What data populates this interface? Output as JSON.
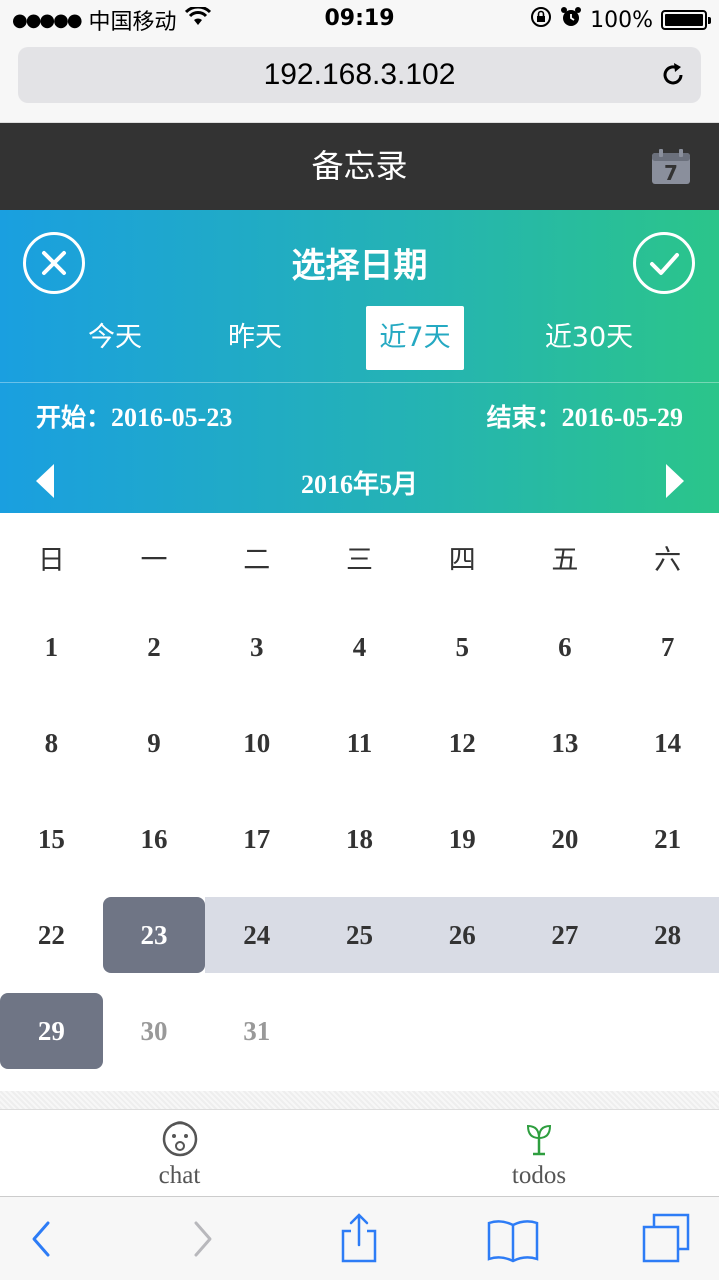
{
  "status_bar": {
    "signal": "●●●●●",
    "carrier": "中国移动",
    "time": "09:19",
    "battery": "100%"
  },
  "browser": {
    "url": "192.168.3.102"
  },
  "app": {
    "title": "备忘录",
    "calendar_icon_day": "7"
  },
  "picker": {
    "title": "选择日期",
    "ranges": [
      {
        "label": "今天",
        "active": false
      },
      {
        "label": "昨天",
        "active": false
      },
      {
        "label": "近7天",
        "active": true
      },
      {
        "label": "近30天",
        "active": false
      }
    ],
    "start_label": "开始：",
    "start_date": "2016-05-23",
    "end_label": "结束：",
    "end_date": "2016-05-29",
    "month": "2016年5月"
  },
  "calendar": {
    "weekdays": [
      "日",
      "一",
      "二",
      "三",
      "四",
      "五",
      "六"
    ],
    "weeks": [
      [
        "1",
        "2",
        "3",
        "4",
        "5",
        "6",
        "7"
      ],
      [
        "8",
        "9",
        "10",
        "11",
        "12",
        "13",
        "14"
      ],
      [
        "15",
        "16",
        "17",
        "18",
        "19",
        "20",
        "21"
      ],
      [
        "22",
        "23",
        "24",
        "25",
        "26",
        "27",
        "28"
      ],
      [
        "29",
        "30",
        "31"
      ]
    ],
    "selected_start": "23",
    "selected_end": "29",
    "muted_days": [
      "30",
      "31"
    ]
  },
  "tabbar": {
    "items": [
      {
        "label": "chat",
        "icon": "baby-face-icon"
      },
      {
        "label": "todos",
        "icon": "sprout-icon"
      }
    ]
  },
  "colors": {
    "header_bg": "#333333",
    "gradient_start": "#1a9fe0",
    "gradient_end": "#2bc58a",
    "selected_day": "#6f7585",
    "range_fill": "#d9dce5",
    "ios_blue": "#2d7cf6"
  }
}
